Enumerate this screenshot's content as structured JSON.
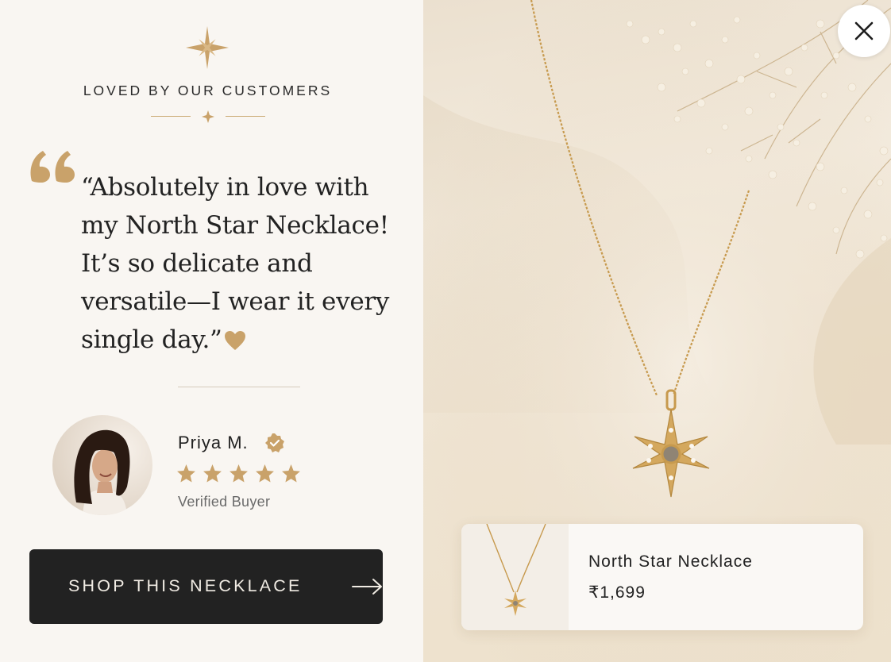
{
  "colors": {
    "gold": "#c9a26a",
    "button_bg": "#222222",
    "panel_bg": "#f9f6f2"
  },
  "testimonial": {
    "heading": "LOVED BY OUR CUSTOMERS",
    "quote": "“Absolutely in love with my North Star Necklace! It’s so delicate and versatile—I wear it every single day.”",
    "reviewer": {
      "name": "Priya M.",
      "rating": 5,
      "rating_max": 5,
      "label": "Verified Buyer"
    },
    "cta_label": "SHOP THIS NECKLACE"
  },
  "product": {
    "name": "North Star Necklace",
    "price": "₹1,699"
  },
  "icons": {
    "close": "close-icon",
    "arrow": "arrow-right-icon",
    "verified": "verified-badge-icon",
    "star": "star-icon",
    "heart": "heart-icon",
    "quote": "quote-icon",
    "sparkle": "sparkle-icon"
  }
}
